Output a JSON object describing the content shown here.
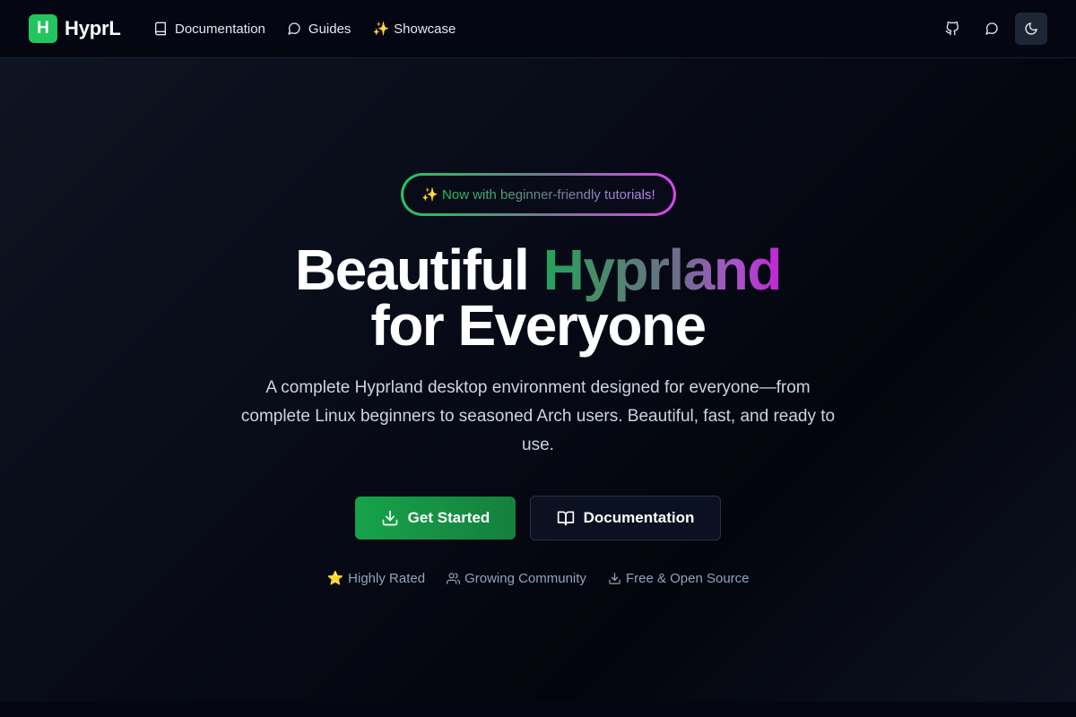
{
  "nav": {
    "brand_letter": "H",
    "brand_name": "HyprL",
    "links": [
      {
        "label": "Documentation",
        "icon": "book-icon"
      },
      {
        "label": "Guides",
        "icon": "chat-bubble-icon"
      },
      {
        "label": "Showcase",
        "icon": "sparkles-emoji",
        "glyph": "✨"
      }
    ],
    "actions": [
      {
        "name": "github-button",
        "icon": "github-icon"
      },
      {
        "name": "community-chat-button",
        "icon": "chat-bubble-icon"
      },
      {
        "name": "theme-toggle-button",
        "icon": "moon-icon"
      }
    ]
  },
  "hero": {
    "badge": {
      "glyph": "✨",
      "text": "Now with beginner-friendly tutorials!"
    },
    "headline_part1": "Beautiful",
    "headline_highlight": "Hyprland",
    "headline_line2": "for Everyone",
    "description": "A complete Hyprland desktop environment designed for everyone—from complete Linux beginners to seasoned Arch users. Beautiful, fast, and ready to use.",
    "primary_cta": {
      "label": "Get Started",
      "icon": "download-icon"
    },
    "secondary_cta": {
      "label": "Documentation",
      "icon": "open-book-icon"
    },
    "features": [
      {
        "label": "Highly Rated",
        "icon": "star-icon",
        "glyph": "⭐"
      },
      {
        "label": "Growing Community",
        "icon": "users-icon"
      },
      {
        "label": "Free & Open Source",
        "icon": "download-icon"
      }
    ]
  },
  "colors": {
    "brand": "#22c55e",
    "primary_button": "#16a34a",
    "background": "#05070f",
    "gradient_end": "#c026d3"
  }
}
